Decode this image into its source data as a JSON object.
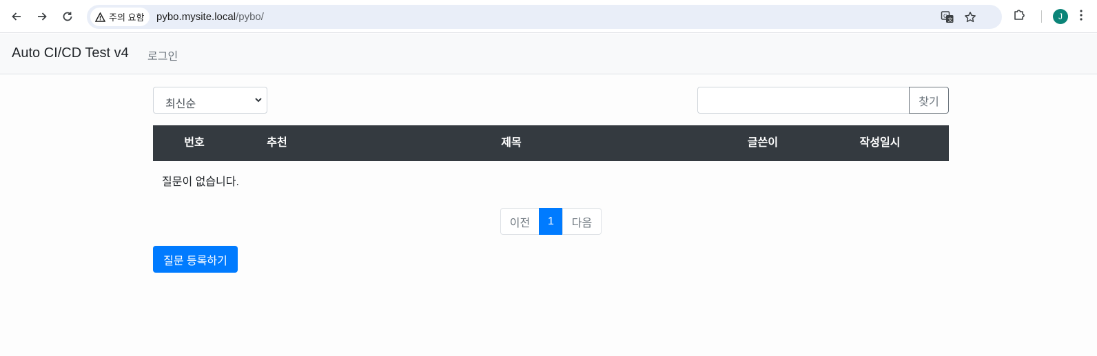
{
  "browser": {
    "security_chip_label": "주의 요함",
    "url_host": "pybo.mysite.local",
    "url_path": "/pybo/",
    "profile_initial": "J"
  },
  "navbar": {
    "brand": "Auto CI/CD Test v4",
    "login_link": "로그인"
  },
  "controls": {
    "sort_select_value": "최신순",
    "search_value": "",
    "search_button": "찾기"
  },
  "table": {
    "headers": [
      "번호",
      "추천",
      "제목",
      "글쓴이",
      "작성일시"
    ],
    "empty_message": "질문이 없습니다."
  },
  "pagination": {
    "prev": "이전",
    "current": "1",
    "next": "다음"
  },
  "actions": {
    "create_question": "질문 등록하기"
  },
  "colors": {
    "primary": "#007bff",
    "table_header_bg": "#343a40",
    "navbar_bg": "#f8f9fa"
  }
}
